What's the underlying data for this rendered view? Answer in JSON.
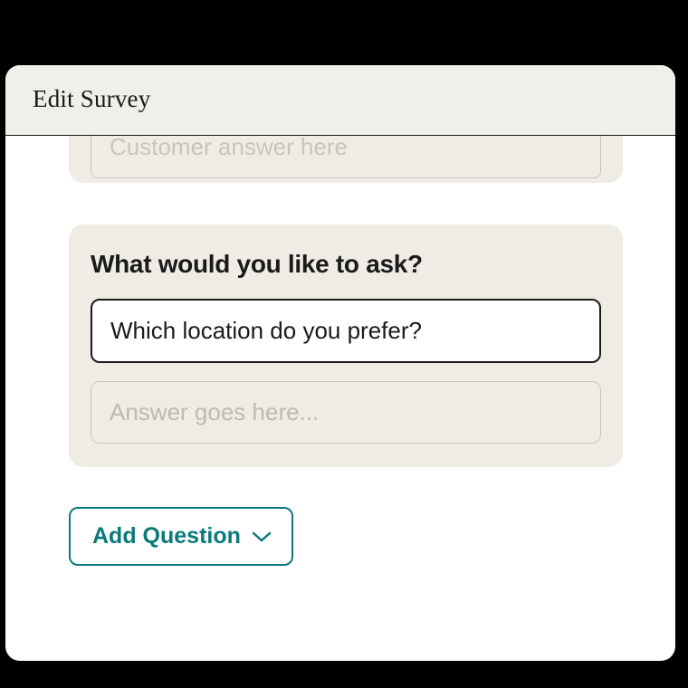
{
  "window": {
    "title": "Edit Survey"
  },
  "partial_card": {
    "answer_placeholder": "Customer answer here"
  },
  "question_card": {
    "prompt": "What would you like to ask?",
    "question_value": "Which location do you prefer?",
    "answer_placeholder": "Answer goes here..."
  },
  "actions": {
    "add_question_label": "Add Question"
  },
  "colors": {
    "accent": "#0b7a7a",
    "card_bg": "#eeece4",
    "titlebar_bg": "#f1efe9"
  }
}
